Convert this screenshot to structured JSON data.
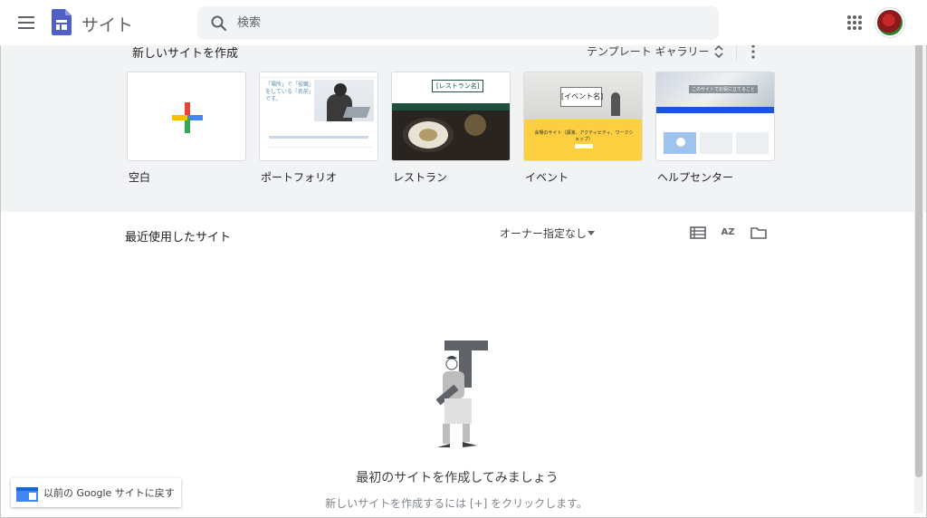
{
  "header": {
    "app_title": "サイト",
    "search_placeholder": "検索",
    "icons": [
      "menu-icon",
      "sites-logo-icon",
      "search-icon",
      "apps-grid-icon",
      "avatar"
    ]
  },
  "templates": {
    "heading": "新しいサイトを作成",
    "gallery_label": "テンプレート ギャラリー",
    "items": [
      {
        "label": "空白"
      },
      {
        "label": "ポートフォリオ",
        "thumb_text": "「場所」で「役職」をしている「名前」です。"
      },
      {
        "label": "レストラン",
        "thumb_title": "[レストラン名]"
      },
      {
        "label": "イベント",
        "thumb_title": "[イベント名]",
        "thumb_text": "会場のサイト（講演、アクティビティ、ワークショップ）"
      },
      {
        "label": "ヘルプセンター",
        "thumb_title": "このサイトでお役に立てること"
      }
    ]
  },
  "recent": {
    "title": "最近使用したサイト",
    "owner_filter": "オーナー指定なし",
    "sort_label": "AZ"
  },
  "empty_state": {
    "title": "最初のサイトを作成してみましょう",
    "subtitle": "新しいサイトを作成するには [+] をクリックします。"
  },
  "classic_sites": {
    "label": "以前の Google サイトに戻す"
  },
  "colors": {
    "sites_blue": "#4e5fc7",
    "band_gray": "#f1f3f4",
    "google_blue": "#4285f4",
    "google_red": "#ea4335",
    "google_yellow": "#fbbc05",
    "google_green": "#34a853"
  }
}
